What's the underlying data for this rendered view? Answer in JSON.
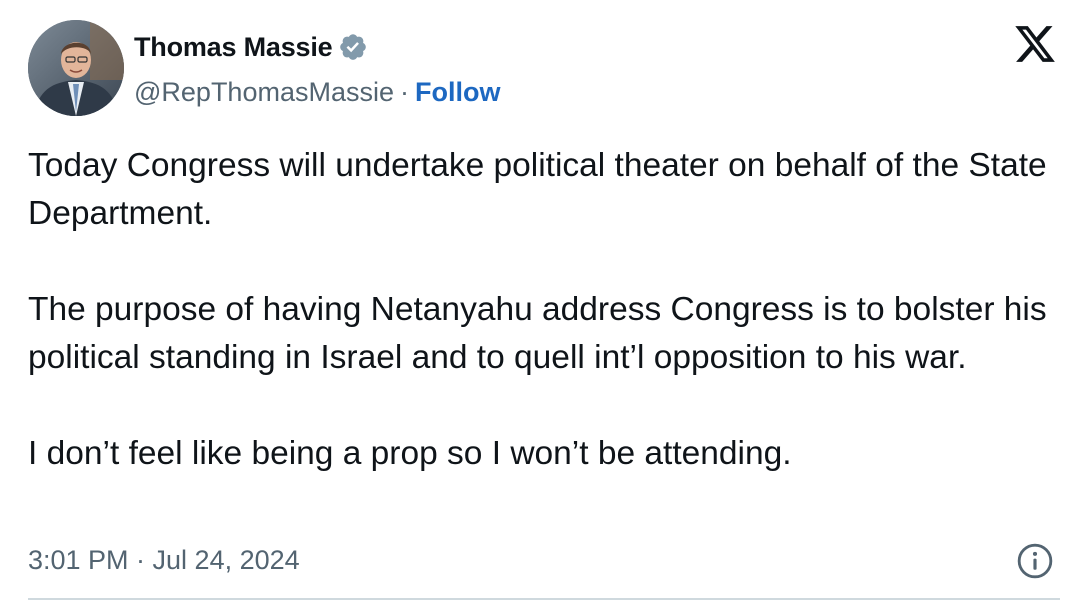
{
  "author": {
    "display_name": "Thomas Massie",
    "handle": "@RepThomasMassie",
    "separator": "·",
    "follow_label": "Follow",
    "verified_badge_color": "#829aab"
  },
  "tweet": {
    "paragraphs": [
      "Today Congress will undertake political theater on behalf of the State Department.",
      "The purpose of having Netanyahu address Congress is to bolster his political standing in Israel and to quell int’l opposition to his war.",
      "I don’t feel like being a prop so I won’t be attending."
    ],
    "timestamp": "3:01 PM · Jul 24, 2024"
  },
  "icons": {
    "verified": "verified-badge-icon",
    "platform": "x-logo-icon",
    "info": "info-icon"
  },
  "colors": {
    "text": "#0f1419",
    "secondary": "#536471",
    "link": "#1d68c1",
    "divider": "#cfd9de"
  }
}
